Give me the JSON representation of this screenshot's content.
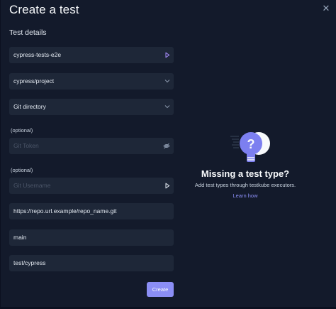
{
  "dialog": {
    "title": "Create a test",
    "close_icon": "close-icon"
  },
  "form": {
    "section_title": "Test details",
    "test_name": {
      "value": "cypress-tests-e2e",
      "icon": "input-end-icon"
    },
    "test_type": {
      "value": "cypress/project",
      "icon": "chevron-down-icon"
    },
    "source_type": {
      "value": "Git directory",
      "icon": "chevron-down-icon"
    },
    "git_token": {
      "label": "(optional)",
      "placeholder": "Git Token",
      "icon": "eye-off-icon"
    },
    "git_username": {
      "label": "(optional)",
      "placeholder": "Git Username",
      "icon": "input-end-icon"
    },
    "repo_uri": {
      "value": "https://repo.url.example/repo_name.git"
    },
    "branch": {
      "value": "main"
    },
    "path": {
      "value": "test/cypress"
    },
    "submit_label": "Create"
  },
  "empty_state": {
    "illustration": "question-lightbulb-icon",
    "title": "Missing a test type?",
    "description": "Add test types through testkube executors.",
    "link_label": "Learn how"
  },
  "colors": {
    "background": "#131a2b",
    "field": "#1e2738",
    "accent": "#8b8ef5",
    "text": "#f8fafc"
  }
}
